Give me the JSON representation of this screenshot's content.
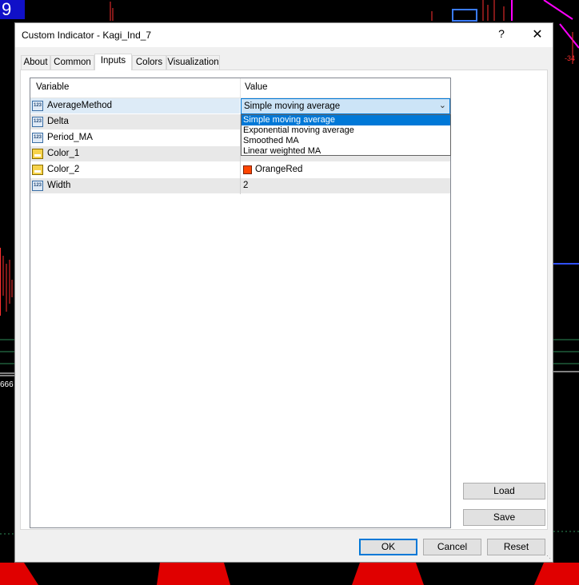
{
  "chart_background": {
    "corner_label": "9",
    "left_readout": "666",
    "colors": {
      "bar_red": "#ff2020",
      "line_magenta": "#ff00ff",
      "line_blue": "#3050ff",
      "grid_green": "#2e8b57"
    }
  },
  "dialog": {
    "title": "Custom Indicator - Kagi_Ind_7",
    "help_glyph": "?",
    "close_glyph": "✕",
    "tabs": [
      {
        "label": "About"
      },
      {
        "label": "Common"
      },
      {
        "label": "Inputs"
      },
      {
        "label": "Colors"
      },
      {
        "label": "Visualization"
      }
    ],
    "active_tab": "Inputs",
    "grid": {
      "col_variable": "Variable",
      "col_value": "Value",
      "rows": [
        {
          "icon": "number-icon",
          "name": "AverageMethod",
          "value": "Simple moving average"
        },
        {
          "icon": "number-icon",
          "name": "Delta",
          "value": ""
        },
        {
          "icon": "number-icon",
          "name": "Period_MA",
          "value": ""
        },
        {
          "icon": "color-icon",
          "name": "Color_1",
          "value": ""
        },
        {
          "icon": "color-icon",
          "name": "Color_2",
          "value": "OrangeRed",
          "swatch": "#ff4500"
        },
        {
          "icon": "number-icon",
          "name": "Width",
          "value": "2"
        }
      ]
    },
    "dropdown": {
      "selected": "Simple moving average",
      "options": [
        "Simple moving average",
        "Exponential moving average",
        "Smoothed MA",
        "Linear weighted MA"
      ]
    },
    "buttons": {
      "load": "Load",
      "save": "Save",
      "ok": "OK",
      "cancel": "Cancel",
      "reset": "Reset"
    }
  }
}
